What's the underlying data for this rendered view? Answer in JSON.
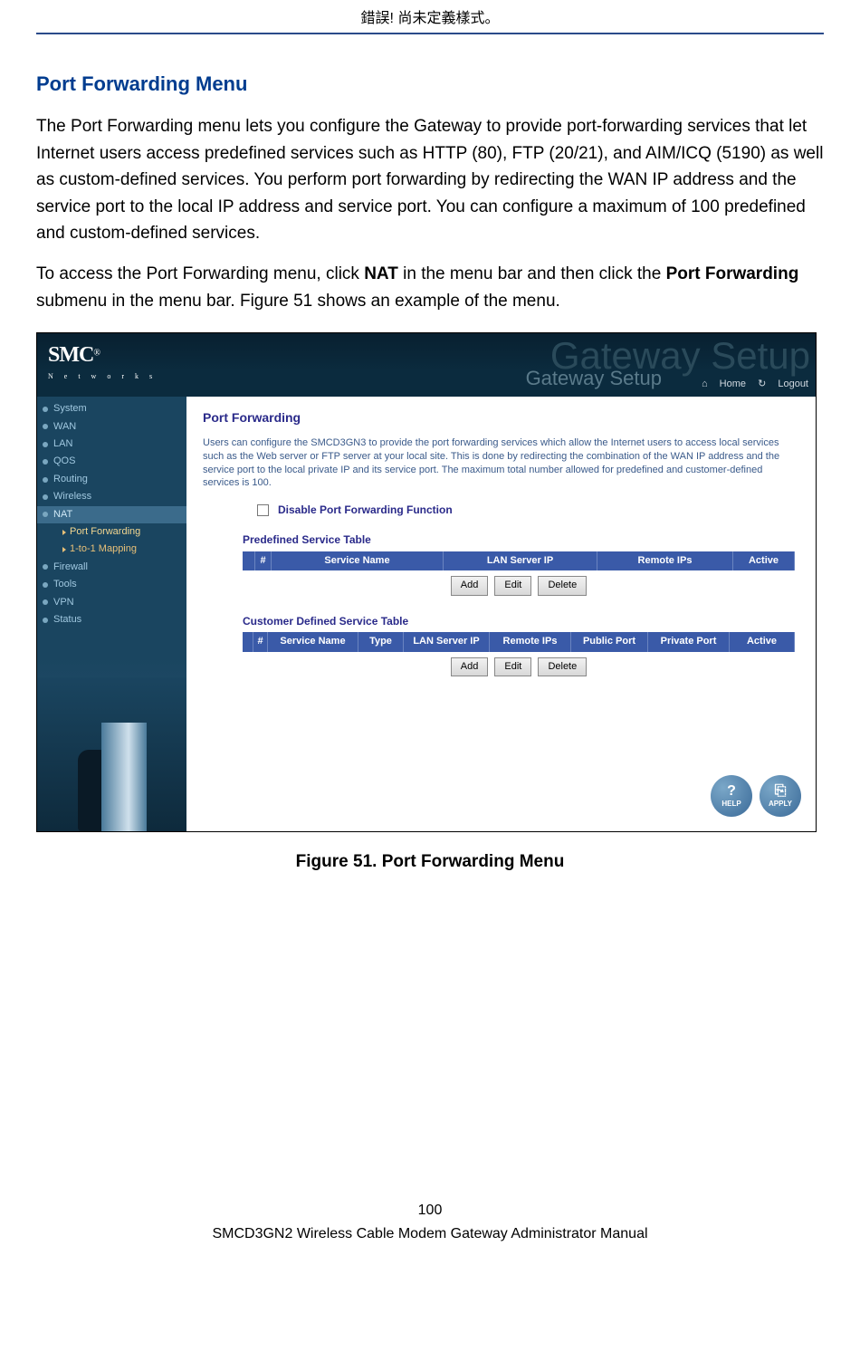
{
  "header_error": "錯誤! 尚未定義樣式。",
  "section_title": "Port Forwarding Menu",
  "para1_a": "The Port Forwarding menu lets you configure the Gateway to provide port-forwarding services that let Internet users access predefined services such as HTTP (80), FTP (20/21), and AIM/ICQ (5190) as well as custom-defined services. You perform port forwarding by redirecting the WAN IP address and the service port to the local IP address and service port. You can configure a maximum of 100 predefined and custom-defined services.",
  "para2_a": "To access the Port Forwarding menu, click ",
  "para2_b": "NAT",
  "para2_c": " in the menu bar and then click the ",
  "para2_d": "Port Forwarding",
  "para2_e": " submenu in the menu bar. Figure 51 shows an example of the menu.",
  "logo_main": "SMC",
  "logo_r": "®",
  "logo_sub": "N e t w o r k s",
  "title_bg": "Gateway Setup",
  "title_fg": "Gateway Setup",
  "link_home": "Home",
  "link_logout": "Logout",
  "nav": {
    "items": [
      {
        "label": "System"
      },
      {
        "label": "WAN"
      },
      {
        "label": "LAN"
      },
      {
        "label": "QOS"
      },
      {
        "label": "Routing"
      },
      {
        "label": "Wireless"
      },
      {
        "label": "NAT"
      },
      {
        "label": "Firewall"
      },
      {
        "label": "Tools"
      },
      {
        "label": "VPN"
      },
      {
        "label": "Status"
      }
    ],
    "sub": [
      {
        "label": "Port Forwarding"
      },
      {
        "label": "1-to-1 Mapping"
      }
    ]
  },
  "main": {
    "title": "Port Forwarding",
    "text": "Users can configure the SMCD3GN3 to provide the port forwarding services which allow the Internet users to access local services such as the Web server or FTP server at your local site. This is done by redirecting the combination of the WAN IP address and the service port to the local private IP and its service port. The maximum total number allowed for predefined and customer-defined services is 100.",
    "disable_label": "Disable Port Forwarding Function",
    "tbl1_title": "Predefined Service Table",
    "tbl1_cols": [
      "",
      "#",
      "Service Name",
      "LAN Server IP",
      "Remote IPs",
      "Active"
    ],
    "tbl2_title": "Customer Defined Service Table",
    "tbl2_cols": [
      "",
      "#",
      "Service Name",
      "Type",
      "LAN Server IP",
      "Remote IPs",
      "Public Port",
      "Private Port",
      "Active"
    ],
    "btn_add": "Add",
    "btn_edit": "Edit",
    "btn_delete": "Delete",
    "btn_help": "HELP",
    "btn_apply": "APPLY"
  },
  "figure_caption": "Figure 51. Port Forwarding Menu",
  "footer_page": "100",
  "footer_text": "SMCD3GN2 Wireless Cable Modem Gateway Administrator Manual"
}
